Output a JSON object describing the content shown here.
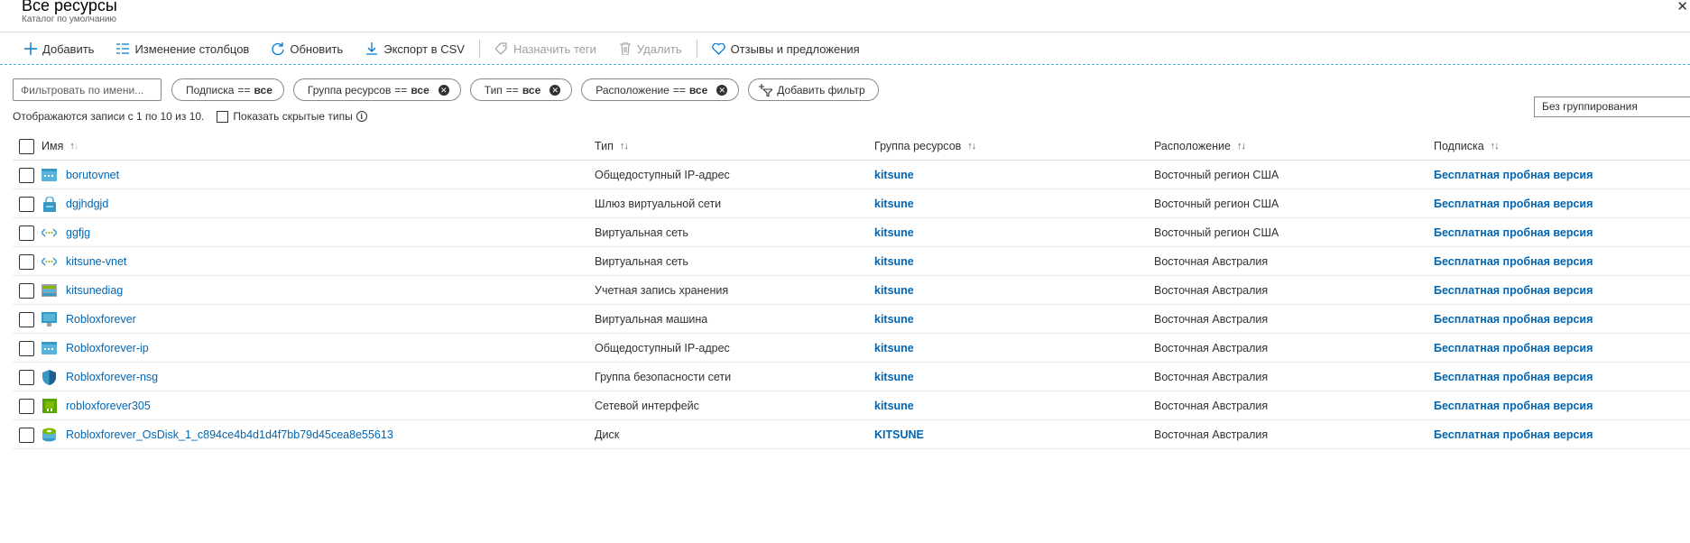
{
  "header": {
    "title": "Все ресурсы",
    "subtitle": "Каталог по умолчанию"
  },
  "toolbar": {
    "add": "Добавить",
    "edit_columns": "Изменение столбцов",
    "refresh": "Обновить",
    "export_csv": "Экспорт в CSV",
    "assign_tags": "Назначить теги",
    "delete": "Удалить",
    "feedback": "Отзывы и предложения"
  },
  "filters": {
    "name_placeholder": "Фильтровать по имени...",
    "subscription": {
      "label": "Подписка",
      "op": "==",
      "value": "все"
    },
    "resource_group": {
      "label": "Группа ресурсов",
      "op": "==",
      "value": "все"
    },
    "type": {
      "label": "Тип",
      "op": "==",
      "value": "все"
    },
    "location": {
      "label": "Расположение",
      "op": "==",
      "value": "все"
    },
    "add_filter": "Добавить фильтр"
  },
  "records_text": "Отображаются записи с 1 по 10 из 10.",
  "show_hidden_label": "Показать скрытые типы",
  "grouping_value": "Без группирования",
  "columns": {
    "name": "Имя",
    "type": "Тип",
    "resource_group": "Группа ресурсов",
    "location": "Расположение",
    "subscription": "Подписка"
  },
  "rows": [
    {
      "name": "borutovnet",
      "icon": "public-ip-icon",
      "type": "Общедоступный IP-адрес",
      "rg": "kitsune",
      "location": "Восточный регион США",
      "subscription": "Бесплатная пробная версия"
    },
    {
      "name": "dgjhdgjd",
      "icon": "vnet-gateway-icon",
      "type": "Шлюз виртуальной сети",
      "rg": "kitsune",
      "location": "Восточный регион США",
      "subscription": "Бесплатная пробная версия"
    },
    {
      "name": "ggfjg",
      "icon": "vnet-icon",
      "type": "Виртуальная сеть",
      "rg": "kitsune",
      "location": "Восточный регион США",
      "subscription": "Бесплатная пробная версия"
    },
    {
      "name": "kitsune-vnet",
      "icon": "vnet-icon",
      "type": "Виртуальная сеть",
      "rg": "kitsune",
      "location": "Восточная Австралия",
      "subscription": "Бесплатная пробная версия"
    },
    {
      "name": "kitsunediag",
      "icon": "storage-icon",
      "type": "Учетная запись хранения",
      "rg": "kitsune",
      "location": "Восточная Австралия",
      "subscription": "Бесплатная пробная версия"
    },
    {
      "name": "Robloxforever",
      "icon": "vm-icon",
      "type": "Виртуальная машина",
      "rg": "kitsune",
      "location": "Восточная Австралия",
      "subscription": "Бесплатная пробная версия"
    },
    {
      "name": "Robloxforever-ip",
      "icon": "public-ip-icon",
      "type": "Общедоступный IP-адрес",
      "rg": "kitsune",
      "location": "Восточная Австралия",
      "subscription": "Бесплатная пробная версия"
    },
    {
      "name": "Robloxforever-nsg",
      "icon": "nsg-shield-icon",
      "type": "Группа безопасности сети",
      "rg": "kitsune",
      "location": "Восточная Австралия",
      "subscription": "Бесплатная пробная версия"
    },
    {
      "name": "robloxforever305",
      "icon": "network-interface-icon",
      "type": "Сетевой интерфейс",
      "rg": "kitsune",
      "location": "Восточная Австралия",
      "subscription": "Бесплатная пробная версия"
    },
    {
      "name": "Robloxforever_OsDisk_1_c894ce4b4d1d4f7bb79d45cea8e55613",
      "icon": "disk-icon",
      "type": "Диск",
      "rg": "KITSUNE",
      "location": "Восточная Австралия",
      "subscription": "Бесплатная пробная версия"
    }
  ]
}
